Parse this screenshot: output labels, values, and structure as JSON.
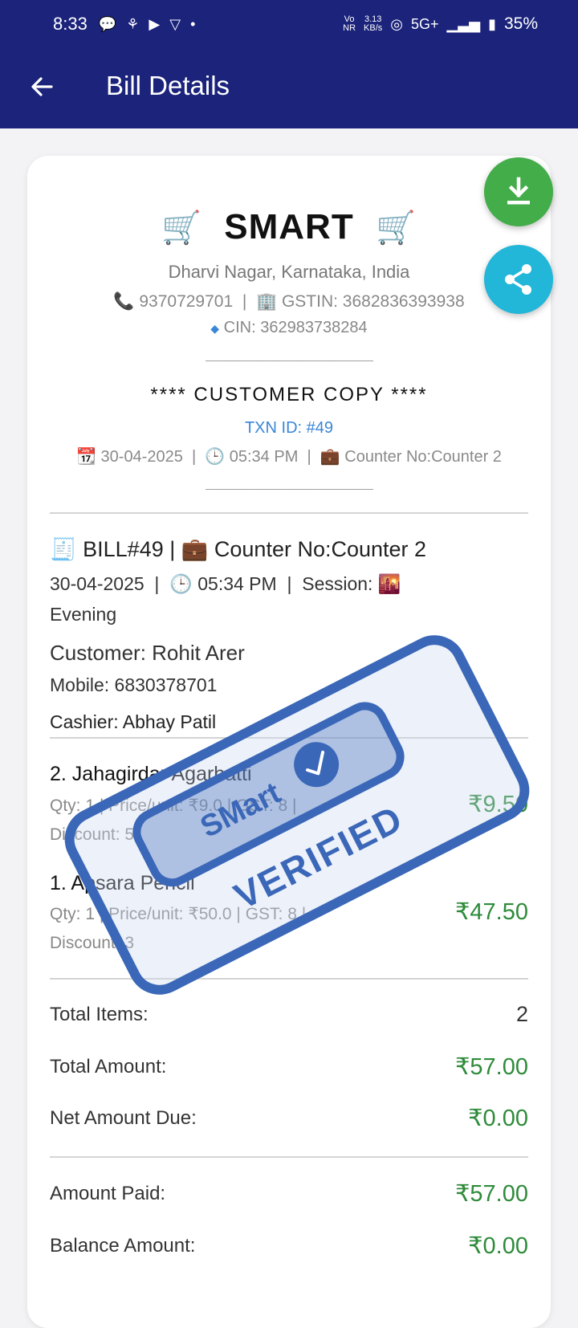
{
  "status_bar": {
    "time": "8:33",
    "net_label_top": "Vo",
    "net_label_bottom": "NR",
    "speed_top": "3.13",
    "speed_bottom": "KB/s",
    "network": "5G+",
    "battery": "35%"
  },
  "app_bar": {
    "title": "Bill Details"
  },
  "store": {
    "name": "SMART",
    "address": "Dharvi Nagar, Karnataka, India",
    "phone": "9370729701",
    "gstin": "GSTIN: 3682836393938",
    "cin": "CIN: 362983738284",
    "divider": "————————————————",
    "copy_label": "**** CUSTOMER COPY ****",
    "txn_id": "TXN ID: #49",
    "date": "30-04-2025",
    "time": "05:34 PM",
    "counter": "Counter No:Counter 2"
  },
  "bill": {
    "number": "BILL#49",
    "counter": "Counter No:Counter 2",
    "date": "30-04-2025",
    "time": "05:34 PM",
    "session_label": "Session:",
    "session": "Evening",
    "customer": "Customer: Rohit Arer",
    "mobile": "Mobile: 6830378701",
    "cashier": "Cashier: Abhay Patil"
  },
  "items": [
    {
      "name": "2. Jahagirdar Agarbatti",
      "details_line1": "Qty: 1 | Price/unit: ₹9.0 | GST: 8 |",
      "details_line2": "Discount: 5",
      "price": "₹9.50"
    },
    {
      "name": "1. Apsara Pencil",
      "details_line1": "Qty: 1 | Price/unit: ₹50.0 | GST: 8 |",
      "details_line2": "Discount: 3",
      "price": "₹47.50"
    }
  ],
  "summary": {
    "total_items_label": "Total Items:",
    "total_items": "2",
    "total_amount_label": "Total Amount:",
    "total_amount": "₹57.00",
    "net_due_label": "Net Amount Due:",
    "net_due": "₹0.00",
    "paid_label": "Amount Paid:",
    "paid": "₹57.00",
    "balance_label": "Balance Amount:",
    "balance": "₹0.00"
  },
  "stamp": {
    "top_text": "SMart",
    "bottom_text": "VERIFIED"
  },
  "colors": {
    "app_bar": "#1b237b",
    "download_fab": "#43ad49",
    "share_fab": "#22b6d8",
    "amount_green": "#2e8b3a",
    "stamp_blue": "#3b67b8"
  }
}
